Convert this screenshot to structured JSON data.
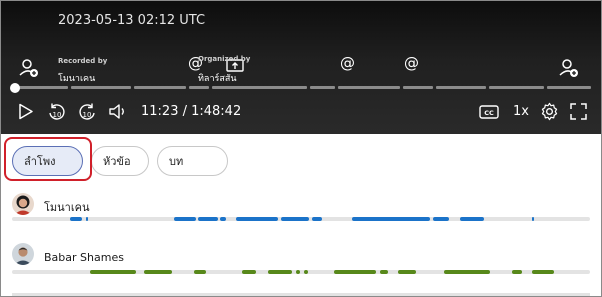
{
  "player": {
    "timestamp": "2023-05-13 02:12 UTC",
    "recorded_by_label": "Recorded by",
    "recorded_by_name": "โมนาเคน",
    "organized_by_label": "Organized by",
    "organized_by_name": "ทิลาร์สสัน",
    "mention_symbol": "@",
    "time": "11:23 / 1:48:42",
    "speed": "1x",
    "progress_fraction": 0.0,
    "icons": [
      "add-person-icon",
      "share-screen-icon",
      "at-icon",
      "add-person-icon",
      "play-icon",
      "rewind-10-icon",
      "forward-10-icon",
      "volume-icon",
      "captions-icon",
      "settings-icon",
      "fullscreen-icon"
    ]
  },
  "tabs": [
    {
      "label": "ลำโพง",
      "selected": true
    },
    {
      "label": "หัวข้อ",
      "selected": false
    },
    {
      "label": "บท",
      "selected": false
    }
  ],
  "speakers": [
    {
      "name": "โมนาเคน",
      "color": "#1b73c9",
      "bar_color_name": "blue"
    },
    {
      "name": "Babar Shames",
      "color": "#57881a",
      "bar_color_name": "green"
    }
  ],
  "colors": {
    "player_bg": "#1a1a1a",
    "accent_selected_tab": "#e6ebf7",
    "highlight_outline": "#d0202a",
    "speaker1_bars": "#1b73c9",
    "speaker2_bars": "#57881a"
  }
}
